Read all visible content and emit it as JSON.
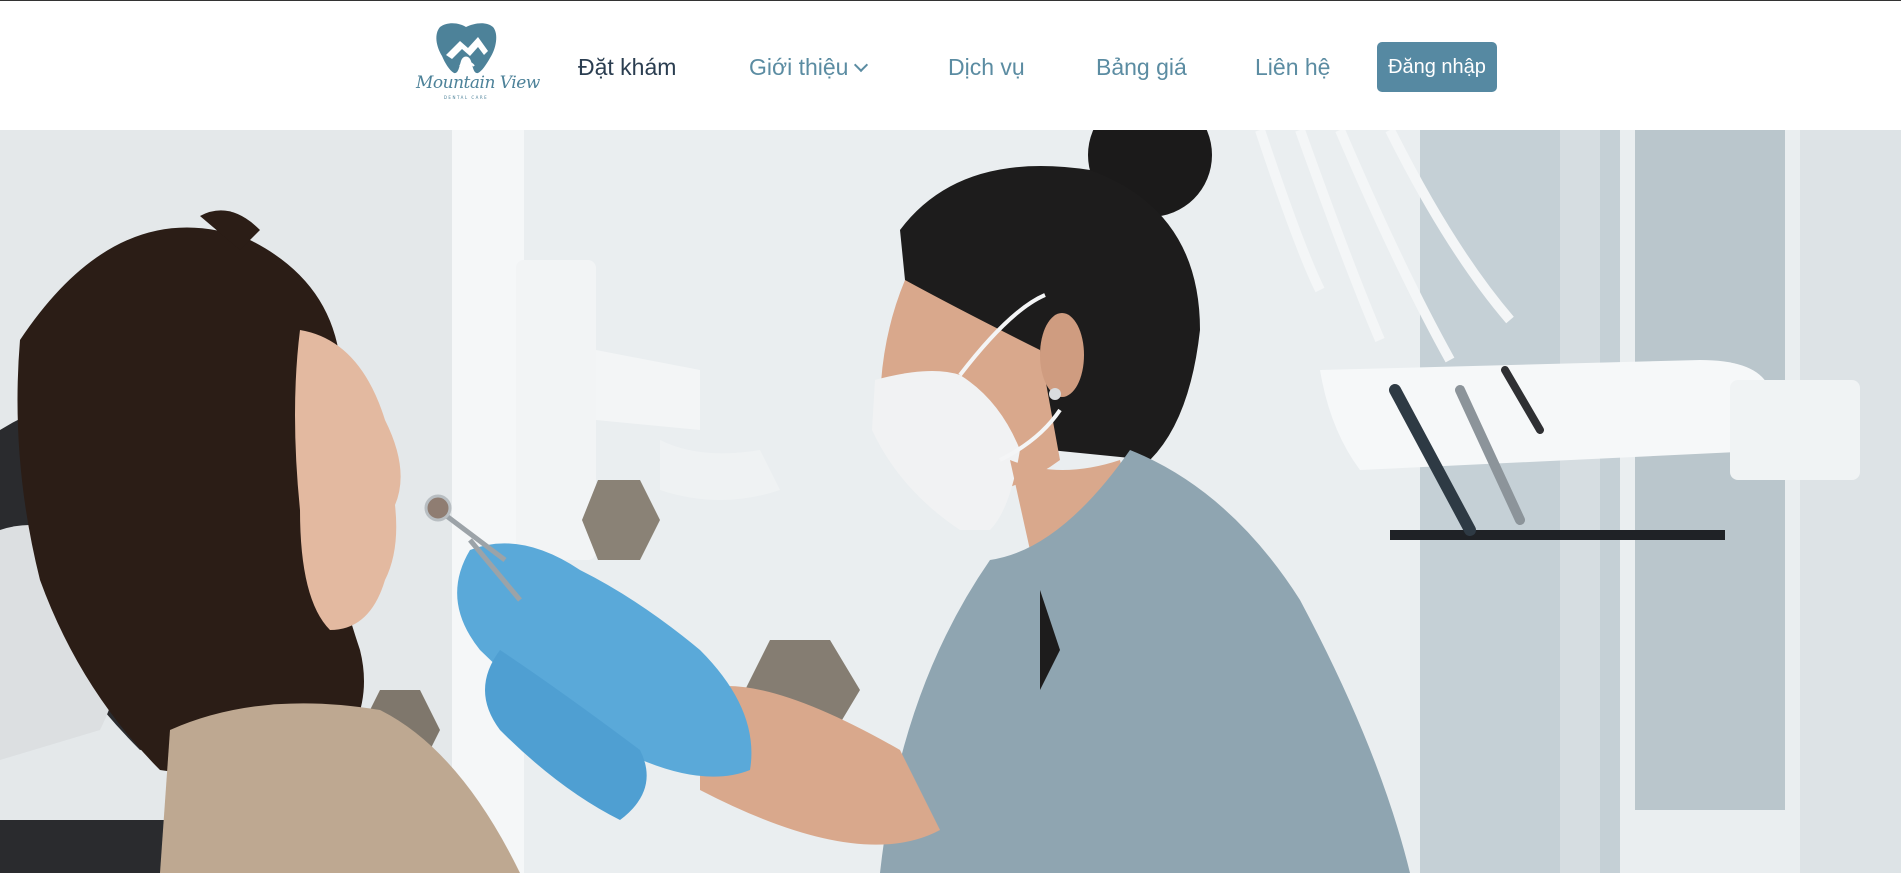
{
  "brand": {
    "name": "Mountain View",
    "tagline": "DENTAL CARE",
    "logo_icon": "tooth-mountain-icon",
    "color": "#4d8299"
  },
  "nav": {
    "items": [
      {
        "label": "Đặt khám",
        "active": true
      },
      {
        "label": "Giới thiệu",
        "dropdown": true,
        "icon": "chevron-down-icon"
      },
      {
        "label": "Dịch vụ"
      },
      {
        "label": "Bảng giá"
      },
      {
        "label": "Liên hệ"
      }
    ],
    "login_label": "Đăng nhập"
  },
  "hero": {
    "image": "dentist-examining-patient-photo"
  },
  "colors": {
    "accent": "#5689a2",
    "nav_text": "#5b8ca2",
    "nav_active": "#2a3d50",
    "glove": "#5aa9d9",
    "scrubs": "#8fa5b1"
  }
}
